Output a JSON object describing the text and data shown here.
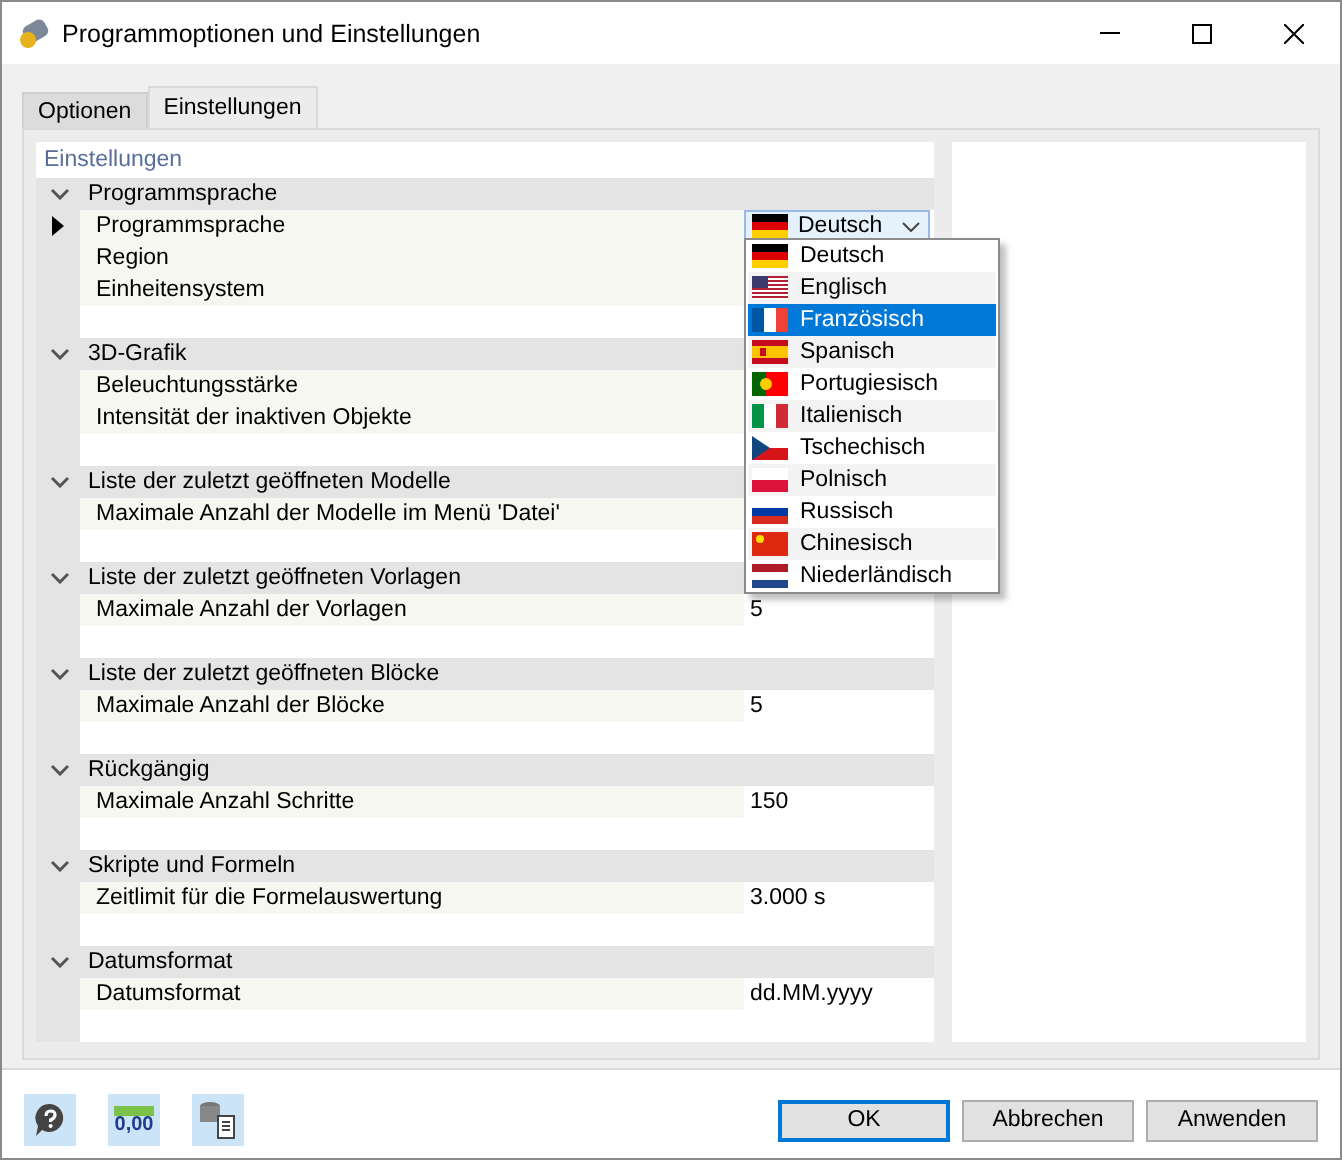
{
  "window": {
    "title": "Programmoptionen und Einstellungen"
  },
  "tabs": [
    {
      "label": "Optionen",
      "selected": false
    },
    {
      "label": "Einstellungen",
      "selected": true
    }
  ],
  "panel": {
    "title": "Einstellungen",
    "groups": [
      {
        "label": "Programmsprache",
        "expanded": true,
        "rows": [
          {
            "label": "Programmsprache",
            "current": true,
            "kind": "combo",
            "value": {
              "label": "Deutsch",
              "kind": "de"
            }
          },
          {
            "label": "Region",
            "current": false
          },
          {
            "label": "Einheitensystem",
            "current": false
          }
        ]
      },
      {
        "label": "3D-Grafik",
        "expanded": true,
        "rows": [
          {
            "label": "Beleuchtungsstärke",
            "current": false
          },
          {
            "label": "Intensität der inaktiven Objekte",
            "current": false
          }
        ]
      },
      {
        "label": "Liste der zuletzt geöffneten Modelle",
        "expanded": true,
        "rows": [
          {
            "label": "Maximale Anzahl der Modelle im Menü 'Datei'",
            "current": false
          }
        ]
      },
      {
        "label": "Liste der zuletzt geöffneten Vorlagen",
        "expanded": true,
        "rows": [
          {
            "label": "Maximale Anzahl der Vorlagen",
            "current": false,
            "value": "5"
          }
        ]
      },
      {
        "label": "Liste der zuletzt geöffneten Blöcke",
        "expanded": true,
        "rows": [
          {
            "label": "Maximale Anzahl der Blöcke",
            "current": false,
            "value": "5"
          }
        ]
      },
      {
        "label": "Rückgängig",
        "expanded": true,
        "rows": [
          {
            "label": "Maximale Anzahl Schritte",
            "current": false,
            "value": "150"
          }
        ]
      },
      {
        "label": "Skripte und Formeln",
        "expanded": true,
        "rows": [
          {
            "label": "Zeitlimit für die Formelauswertung",
            "current": false,
            "value": "3.000 s"
          }
        ]
      },
      {
        "label": "Datumsformat",
        "expanded": true,
        "rows": [
          {
            "label": "Datumsformat",
            "current": false,
            "value": "dd.MM.yyyy"
          }
        ]
      }
    ]
  },
  "dropdown": {
    "options": [
      {
        "label": "Deutsch",
        "kind": "de",
        "selected": false
      },
      {
        "label": "Englisch",
        "kind": "us",
        "selected": false
      },
      {
        "label": "Französisch",
        "kind": "fr",
        "selected": true
      },
      {
        "label": "Spanisch",
        "kind": "es",
        "selected": false
      },
      {
        "label": "Portugiesisch",
        "kind": "pt",
        "selected": false
      },
      {
        "label": "Italienisch",
        "kind": "it",
        "selected": false
      },
      {
        "label": "Tschechisch",
        "kind": "cz",
        "selected": false
      },
      {
        "label": "Polnisch",
        "kind": "pl",
        "selected": false
      },
      {
        "label": "Russisch",
        "kind": "ru",
        "selected": false
      },
      {
        "label": "Chinesisch",
        "kind": "cn",
        "selected": false
      },
      {
        "label": "Niederländisch",
        "kind": "nl",
        "selected": false
      }
    ]
  },
  "footer": {
    "units_label": "0,00",
    "buttons": [
      {
        "label": "OK",
        "default": true
      },
      {
        "label": "Abbrechen",
        "default": false
      },
      {
        "label": "Anwenden",
        "default": false
      }
    ]
  }
}
